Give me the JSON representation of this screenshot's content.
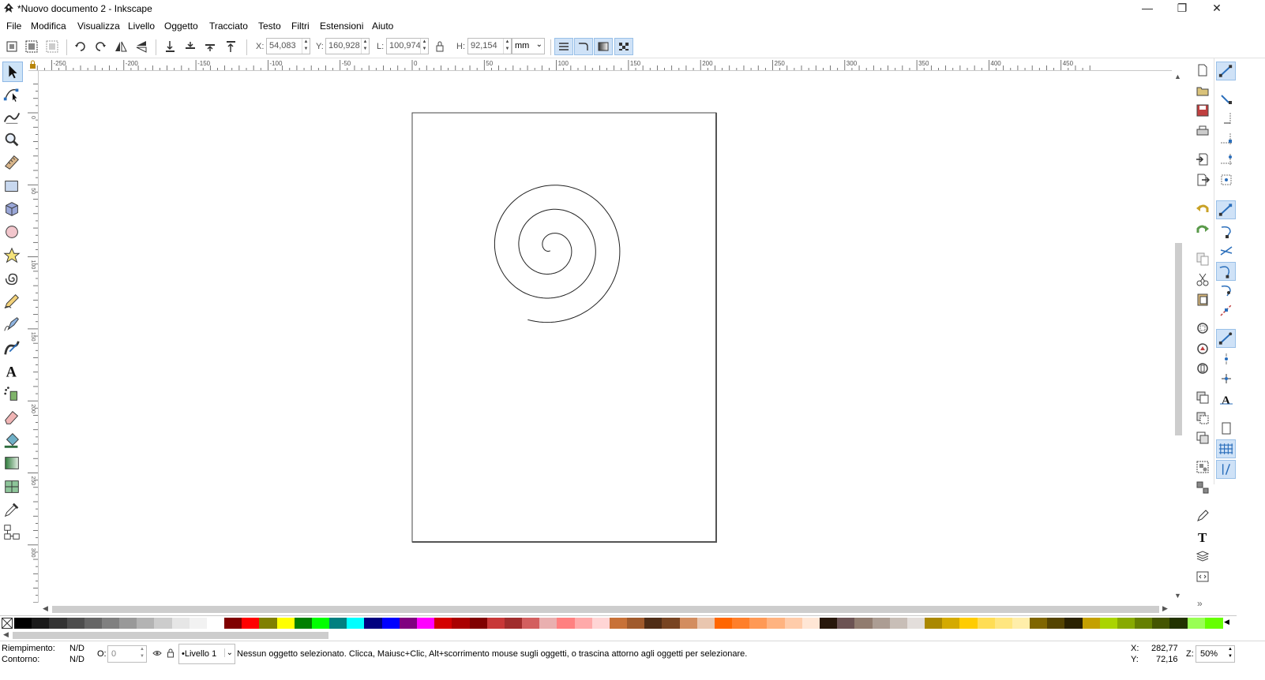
{
  "window": {
    "title": "*Nuovo documento 2 - Inkscape",
    "minimize": "—",
    "restore": "❐",
    "close": "✕"
  },
  "menu": [
    "File",
    "Modifica",
    "Visualizza",
    "Livello",
    "Oggetto",
    "Tracciato",
    "Testo",
    "Filtri",
    "Estensioni",
    "Aiuto"
  ],
  "toolbar": {
    "x_label": "X:",
    "x_value": "54,083",
    "y_label": "Y:",
    "y_value": "160,928",
    "w_label": "L:",
    "w_value": "100,974",
    "h_label": "H:",
    "h_value": "92,154",
    "unit": "mm"
  },
  "ruler": {
    "h_labels": [
      "-250",
      "-200",
      "-150",
      "-100",
      "-50",
      "0",
      "50",
      "100",
      "150",
      "200",
      "250",
      "300",
      "350",
      "400",
      "450"
    ],
    "v_labels": [
      "0",
      "50",
      "100",
      "150",
      "200",
      "250",
      "300",
      "350",
      "400",
      "450",
      "500"
    ]
  },
  "tools": [
    "selector-tool",
    "node-tool",
    "tweak-tool",
    "zoom-tool",
    "measure-tool",
    "rect-tool",
    "3dbox-tool",
    "ellipse-tool",
    "star-tool",
    "spiral-tool",
    "pencil-tool",
    "pen-tool",
    "calligraphy-tool",
    "text-tool",
    "spray-tool",
    "eraser-tool",
    "bucket-tool",
    "gradient-tool",
    "mesh-tool",
    "dropper-tool",
    "connector-tool"
  ],
  "palette_colors": [
    "#000000",
    "#1a1a1a",
    "#333333",
    "#4d4d4d",
    "#666666",
    "#808080",
    "#999999",
    "#b3b3b3",
    "#cccccc",
    "#e6e6e6",
    "#f2f2f2",
    "#ffffff",
    "#800000",
    "#ff0000",
    "#808000",
    "#ffff00",
    "#008000",
    "#00ff00",
    "#008080",
    "#00ffff",
    "#000080",
    "#0000ff",
    "#800080",
    "#ff00ff",
    "#d40000",
    "#aa0000",
    "#800000",
    "#c83737",
    "#a02c2c",
    "#d35f5f",
    "#e9afaf",
    "#ff8080",
    "#ffaaaa",
    "#ffd5d5",
    "#c87137",
    "#a05a2c",
    "#502d16",
    "#784421",
    "#d38d5f",
    "#e9c6af",
    "#ff6600",
    "#ff7f2a",
    "#ff9955",
    "#ffb380",
    "#ffccaa",
    "#ffe6d5",
    "#28170b",
    "#6c5353",
    "#917c6f",
    "#ac9d93",
    "#c8beb7",
    "#e3dedb",
    "#aa8800",
    "#d4aa00",
    "#ffcc00",
    "#ffdd55",
    "#ffe680",
    "#ffeeaa",
    "#806600",
    "#554400",
    "#2b2200",
    "#c4a000",
    "#aad400",
    "#88aa00",
    "#668000",
    "#445500",
    "#223300",
    "#99ff55",
    "#66ff00"
  ],
  "status": {
    "fill_label": "Riempimento:",
    "fill_value": "N/D",
    "stroke_label": "Contorno:",
    "stroke_value": "N/D",
    "opacity_label": "O:",
    "opacity_value": "0",
    "layer": "•Livello 1",
    "message": "Nessun oggetto selezionato. Clicca, Maiusc+Clic, Alt+scorrimento mouse sugli oggetti, o trascina attorno agli oggetti per selezionare.",
    "cursor_x_label": "X:",
    "cursor_x": "282,77",
    "cursor_y_label": "Y:",
    "cursor_y": "72,16",
    "zoom_label": "Z:",
    "zoom": "50%"
  },
  "colors": {
    "accent": "#cfe2f7",
    "accent_border": "#99c0e8",
    "page_border": "#555555"
  }
}
